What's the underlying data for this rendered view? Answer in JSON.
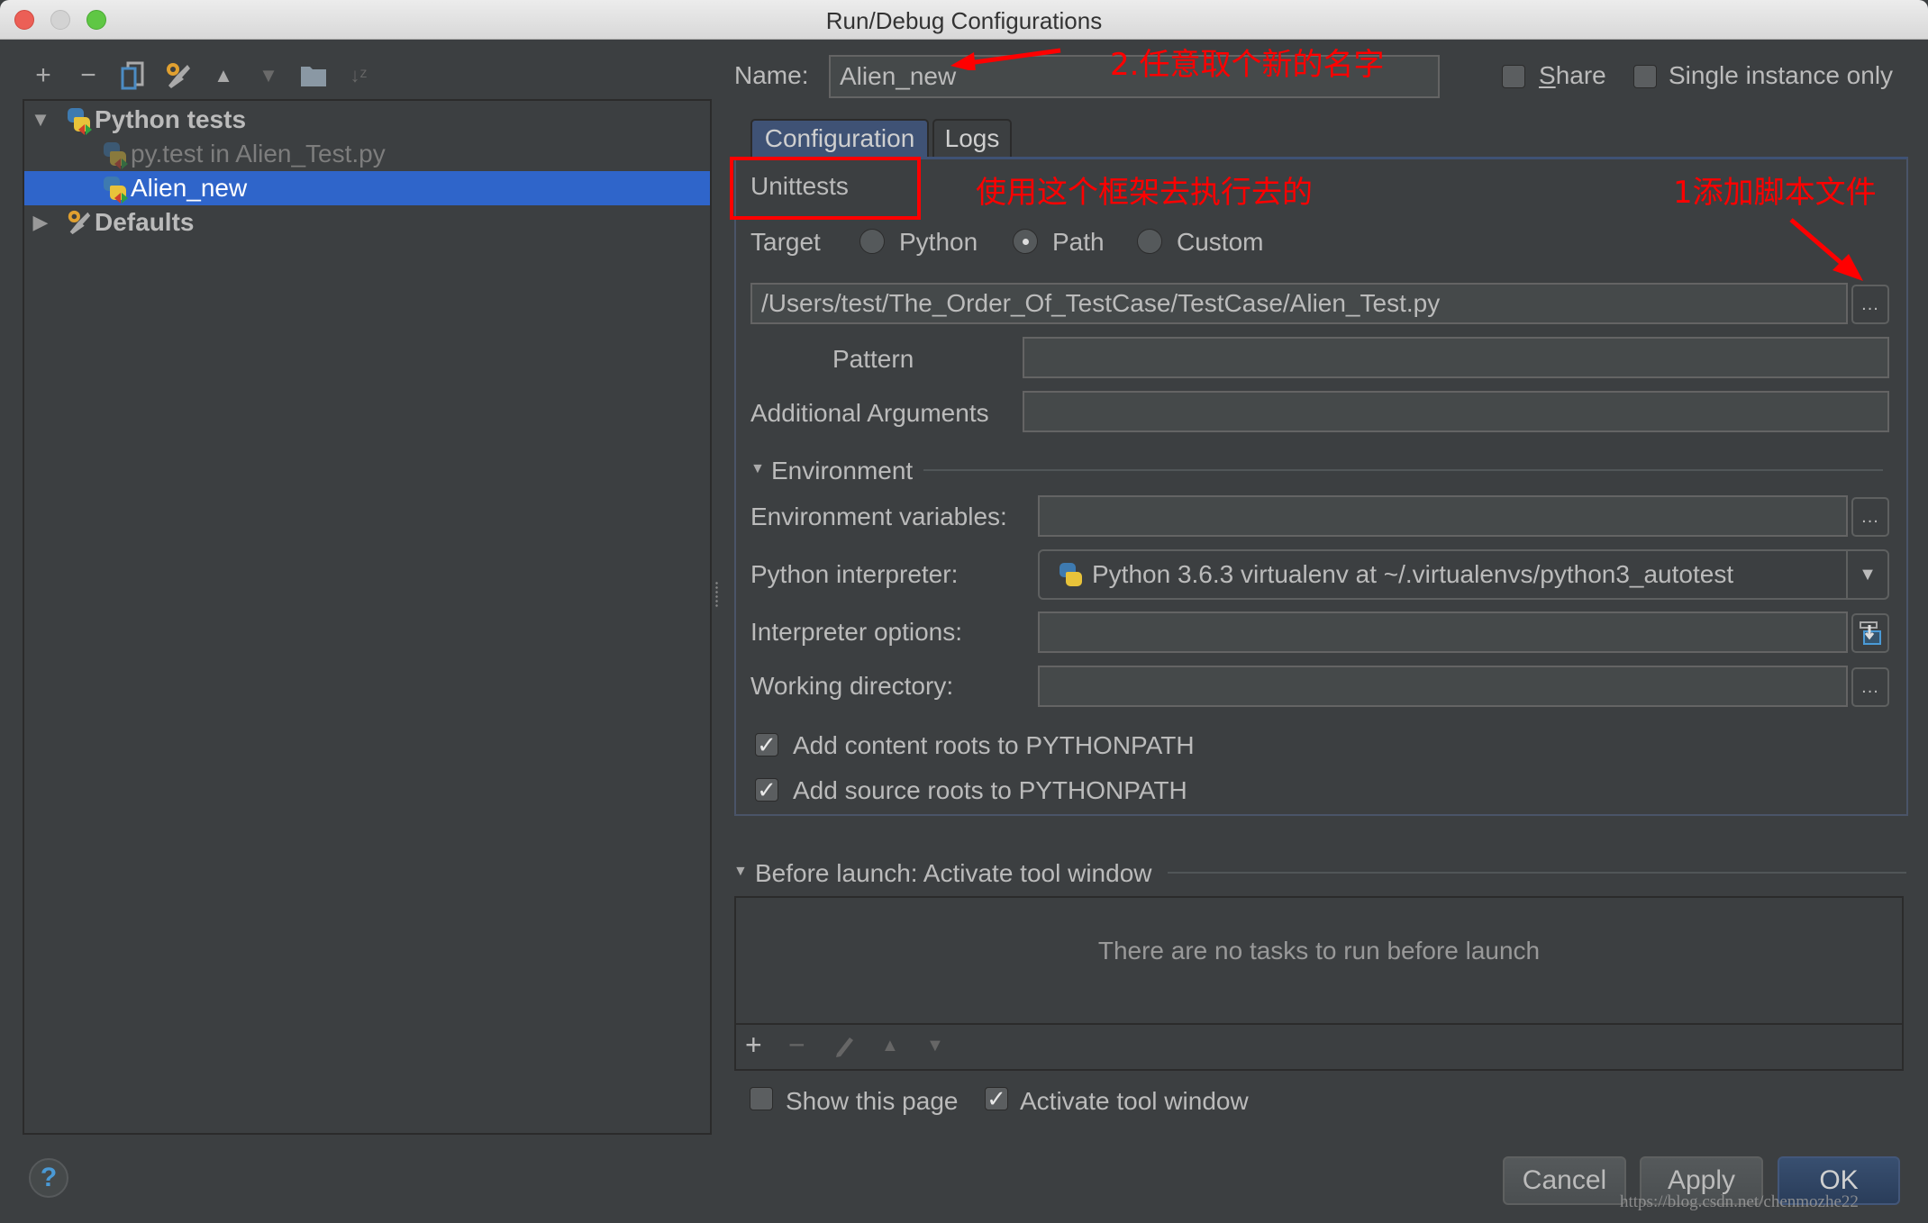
{
  "window": {
    "title": "Run/Debug Configurations",
    "traffic_lights": [
      "close",
      "minimize",
      "zoom"
    ]
  },
  "toolbar": {
    "icons": [
      "add-icon",
      "remove-icon",
      "copy-icon",
      "wrench-icon",
      "move-up-icon",
      "move-down-icon",
      "folder-icon",
      "sort-alpha-icon"
    ]
  },
  "tree": {
    "items": [
      {
        "label": "Python tests",
        "expanded": true,
        "bold": true
      },
      {
        "label": "py.test in Alien_Test.py",
        "dimmed": true
      },
      {
        "label": "Alien_new",
        "selected": true
      },
      {
        "label": "Defaults",
        "expanded": false,
        "bold": true
      }
    ]
  },
  "header": {
    "name_label": "Name:",
    "name_value": "Alien_new",
    "share_label": "Share",
    "share_checked": false,
    "single_instance_label": "Single instance only",
    "single_instance_checked": false
  },
  "tabs": [
    {
      "label": "Configuration",
      "active": true
    },
    {
      "label": "Logs",
      "active": false
    }
  ],
  "config": {
    "framework": "Unittests",
    "target_label": "Target",
    "target_options": [
      {
        "label": "Python",
        "selected": false
      },
      {
        "label": "Path",
        "selected": true
      },
      {
        "label": "Custom",
        "selected": false
      }
    ],
    "path_value": "/Users/test/The_Order_Of_TestCase/TestCase/Alien_Test.py",
    "browse_label": "...",
    "pattern_label": "Pattern",
    "pattern_value": "",
    "additional_args_label": "Additional Arguments",
    "additional_args_value": "",
    "environment_header": "Environment",
    "env_vars_label": "Environment variables:",
    "env_vars_value": "",
    "interpreter_label": "Python interpreter:",
    "interpreter_value": "Python 3.6.3 virtualenv at ~/.virtualenvs/python3_autotest",
    "interp_options_label": "Interpreter options:",
    "interp_options_value": "",
    "working_dir_label": "Working directory:",
    "working_dir_value": "",
    "add_content_roots_label": "Add content roots to PYTHONPATH",
    "add_content_roots_checked": true,
    "add_source_roots_label": "Add source roots to PYTHONPATH",
    "add_source_roots_checked": true
  },
  "before_launch": {
    "header": "Before launch: Activate tool window",
    "empty_text": "There are no tasks to run before launch",
    "show_page_label": "Show this page",
    "show_page_checked": false,
    "activate_tool_label": "Activate tool window",
    "activate_tool_checked": true
  },
  "buttons": {
    "cancel": "Cancel",
    "apply": "Apply",
    "ok": "OK",
    "help": "?"
  },
  "annotations": {
    "name_note": "2.任意取个新的名字",
    "framework_note": "使用这个框架去执行去的",
    "add_script_note": "1添加脚本文件"
  },
  "watermark": "https://blog.csdn.net/chenmozhe22",
  "colors": {
    "background": "#3c3f41",
    "selection": "#2f65ca",
    "annotation": "#ff0000",
    "ok_button": "#2f4566"
  }
}
